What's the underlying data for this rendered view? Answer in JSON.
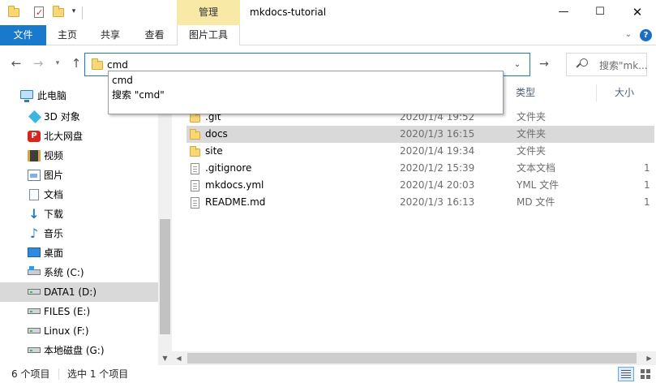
{
  "window": {
    "title": "mkdocs-tutorial",
    "contextual_tab_group": "管理",
    "controls": {
      "minimize": "—",
      "maximize": "☐",
      "close": "✕"
    }
  },
  "quick_access": [
    "folder-icon",
    "properties-icon",
    "new-folder-icon",
    "customize-dropdown-icon"
  ],
  "ribbon": {
    "tabs": [
      {
        "label": "文件",
        "active": true
      },
      {
        "label": "主页"
      },
      {
        "label": "共享"
      },
      {
        "label": "查看"
      },
      {
        "label": "图片工具"
      }
    ],
    "expand_icon": "chevron-down-icon",
    "help_icon": "?"
  },
  "address_bar": {
    "value": "cmd",
    "search_placeholder": "搜索\"mk..."
  },
  "autocomplete": {
    "items": [
      "cmd",
      "搜索 \"cmd\""
    ]
  },
  "sidebar": {
    "items": [
      {
        "label": "此电脑",
        "icon": "computer-icon"
      },
      {
        "label": "3D 对象",
        "icon": "3d-objects-icon"
      },
      {
        "label": "北大网盘",
        "icon": "cloud-drive-icon"
      },
      {
        "label": "视频",
        "icon": "video-icon"
      },
      {
        "label": "图片",
        "icon": "pictures-icon"
      },
      {
        "label": "文档",
        "icon": "documents-icon"
      },
      {
        "label": "下载",
        "icon": "downloads-icon"
      },
      {
        "label": "音乐",
        "icon": "music-icon"
      },
      {
        "label": "桌面",
        "icon": "desktop-icon"
      },
      {
        "label": "系统 (C:)",
        "icon": "system-drive-icon"
      },
      {
        "label": "DATA1 (D:)",
        "icon": "drive-icon",
        "selected": true
      },
      {
        "label": "FILES (E:)",
        "icon": "drive-icon"
      },
      {
        "label": "Linux (F:)",
        "icon": "drive-icon"
      },
      {
        "label": "本地磁盘 (G:)",
        "icon": "drive-icon"
      }
    ]
  },
  "file_list": {
    "columns": {
      "type": "类型",
      "size": "大小"
    },
    "rows": [
      {
        "name": ".git",
        "date": "2020/1/4 19:52",
        "type": "文件夹",
        "size": "",
        "kind": "folder"
      },
      {
        "name": "docs",
        "date": "2020/1/3 16:15",
        "type": "文件夹",
        "size": "",
        "kind": "folder",
        "selected": true
      },
      {
        "name": "site",
        "date": "2020/1/4 19:34",
        "type": "文件夹",
        "size": "",
        "kind": "folder"
      },
      {
        "name": ".gitignore",
        "date": "2020/1/2 15:39",
        "type": "文本文档",
        "size": "1",
        "kind": "file"
      },
      {
        "name": "mkdocs.yml",
        "date": "2020/1/4 20:03",
        "type": "YML 文件",
        "size": "1",
        "kind": "file"
      },
      {
        "name": "README.md",
        "date": "2020/1/3 16:13",
        "type": "MD 文件",
        "size": "1",
        "kind": "file"
      }
    ]
  },
  "status_bar": {
    "item_count": "6 个项目",
    "selection": "选中 1 个项目"
  },
  "colors": {
    "accent": "#1979ca",
    "contextual_tab": "#f9e9a6",
    "selection_gray": "#d9d9d9",
    "folder": "#f8d775"
  }
}
